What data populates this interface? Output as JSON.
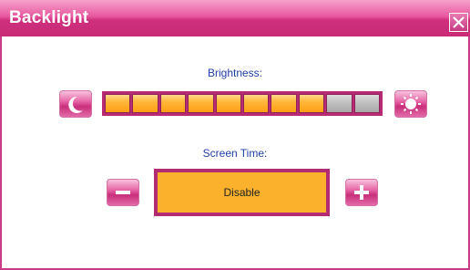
{
  "window": {
    "title": "Backlight",
    "close_icon": "close-icon"
  },
  "brightness": {
    "label": "Brightness:",
    "level": 8,
    "max": 10,
    "decrease_icon": "moon-icon",
    "increase_icon": "sun-icon"
  },
  "screen_time": {
    "label": "Screen Time:",
    "value": "Disable",
    "decrease_icon": "minus-icon",
    "increase_icon": "plus-icon"
  },
  "colors": {
    "accent": "#c92b77",
    "label_text": "#1f3fa8",
    "active_segment": "#ffb63a",
    "inactive_segment": "#bdbdbd",
    "value_box": "#fbb12c"
  }
}
